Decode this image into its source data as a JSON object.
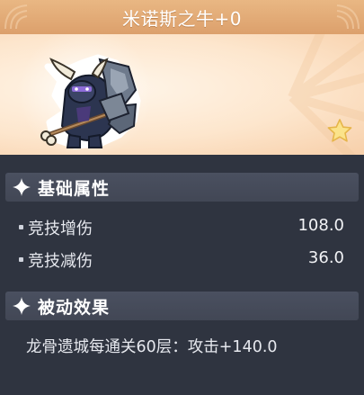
{
  "title": "米诺斯之牛+0",
  "item": {
    "art_icon": "minotaur-bull-card-art",
    "star_icon": "star-icon"
  },
  "sections": {
    "basic_attributes": {
      "title": "基础属性",
      "stats": [
        {
          "label": "竞技增伤",
          "value": "108.0"
        },
        {
          "label": "竞技减伤",
          "value": "36.0"
        }
      ]
    },
    "passive_effect": {
      "title": "被动效果",
      "text": "龙骨遗城每通关60层：攻击+140.0"
    }
  },
  "colors": {
    "title_bar": "#dca06c",
    "banner": "#fde6cd",
    "panel": "#2f3440",
    "section_header": "#4a5060",
    "text": "#e6e8ee"
  }
}
